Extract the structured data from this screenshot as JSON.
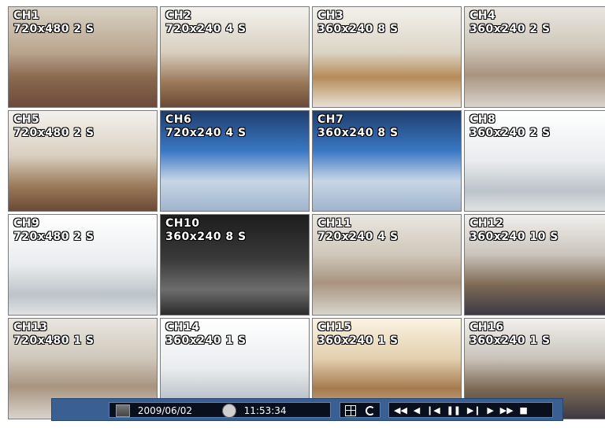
{
  "channels": [
    {
      "name": "CH1",
      "info": "720x480 2 S",
      "scene": "lobby"
    },
    {
      "name": "CH2",
      "info": "720x240 4 S",
      "scene": "office"
    },
    {
      "name": "CH3",
      "info": "360x240 8 S",
      "scene": "glass"
    },
    {
      "name": "CH4",
      "info": "360x240 2 S",
      "scene": "hall"
    },
    {
      "name": "CH5",
      "info": "720x480 2 S",
      "scene": "office"
    },
    {
      "name": "CH6",
      "info": "720x240 4 S",
      "scene": "blue"
    },
    {
      "name": "CH7",
      "info": "360x240 8 S",
      "scene": "blue"
    },
    {
      "name": "CH8",
      "info": "360x240 2 S",
      "scene": "white"
    },
    {
      "name": "CH9",
      "info": "720x480 2 S",
      "scene": "white"
    },
    {
      "name": "CH10",
      "info": "360x240 8 S",
      "scene": "dark"
    },
    {
      "name": "CH11",
      "info": "720x240 4 S",
      "scene": "hall"
    },
    {
      "name": "CH12",
      "info": "360x240 10 S",
      "scene": "conf"
    },
    {
      "name": "CH13",
      "info": "720x480 1 S",
      "scene": "hall"
    },
    {
      "name": "CH14",
      "info": "360x240 1 S",
      "scene": "white"
    },
    {
      "name": "CH15",
      "info": "360x240 1 S",
      "scene": "elev"
    },
    {
      "name": "CH16",
      "info": "360x240 1 S",
      "scene": "conf"
    }
  ],
  "status": {
    "date": "2009/06/02",
    "time": "11:53:34",
    "mode": "PAUSE"
  },
  "colors": {
    "toolbar": "#3a5f93",
    "segment": "#0a0f1e"
  }
}
